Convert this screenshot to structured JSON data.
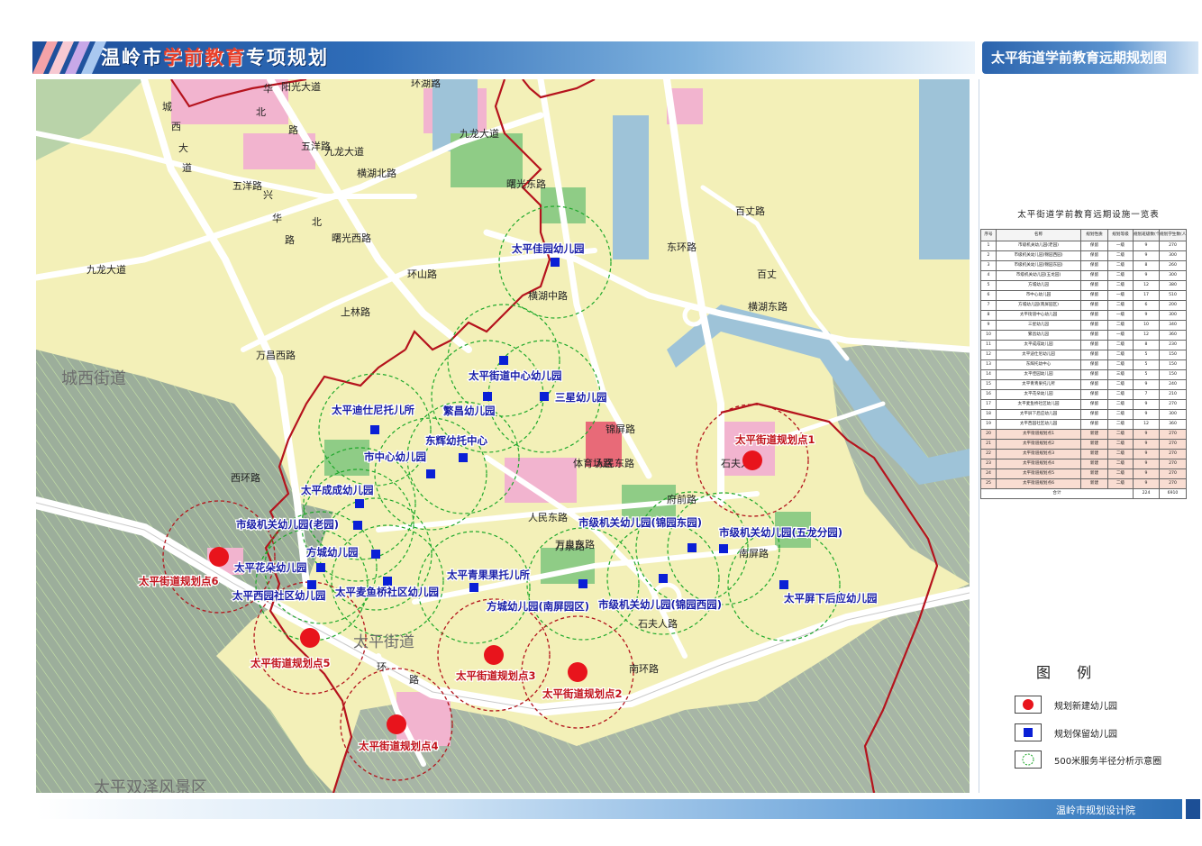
{
  "header": {
    "title_parts": [
      {
        "text": "温岭市",
        "accent": false
      },
      {
        "text": "学前教育",
        "accent": true
      },
      {
        "text": "专项规划",
        "accent": false
      }
    ],
    "right_title": "太平街道学前教育远期规划图"
  },
  "colors": {
    "new_marker": "#e8141c",
    "keep_marker": "#0a1fd6",
    "new_label": "#c1121a",
    "keep_label": "#1a1fa8",
    "radius_new": "#b3141c",
    "radius_keep": "#1ea82a",
    "boundary": "#b5131d"
  },
  "map": {
    "district_labels": [
      {
        "text": "城西街道"
      },
      {
        "text": "太平街道"
      },
      {
        "text": "太平双泽风景区"
      }
    ],
    "road_labels": [
      {
        "text": "阳光大道"
      },
      {
        "text": "华"
      },
      {
        "text": "北"
      },
      {
        "text": "路"
      },
      {
        "text": "城"
      },
      {
        "text": "西"
      },
      {
        "text": "大"
      },
      {
        "text": "道"
      },
      {
        "text": "五洋路"
      },
      {
        "text": "五洋路"
      },
      {
        "text": "横湖北路"
      },
      {
        "text": "九龙大道"
      },
      {
        "text": "九龙大道"
      },
      {
        "text": "九龙大道"
      },
      {
        "text": "曙光东路"
      },
      {
        "text": "曙光西路"
      },
      {
        "text": "环湖路"
      },
      {
        "text": "兴"
      },
      {
        "text": "华"
      },
      {
        "text": "北"
      },
      {
        "text": "路"
      },
      {
        "text": "上林路"
      },
      {
        "text": "万昌西路"
      },
      {
        "text": "环山路"
      },
      {
        "text": "横湖中路"
      },
      {
        "text": "东环路"
      },
      {
        "text": "百丈路"
      },
      {
        "text": "百丈"
      },
      {
        "text": "横湖东路"
      },
      {
        "text": "锦屏路"
      },
      {
        "text": "人民东路"
      },
      {
        "text": "人民东路"
      },
      {
        "text": "万泉东路"
      },
      {
        "text": "万泉路"
      },
      {
        "text": "石夫人路"
      },
      {
        "text": "石夫人路"
      },
      {
        "text": "南屏路"
      },
      {
        "text": "南环路"
      },
      {
        "text": "体育场路"
      },
      {
        "text": "西环路"
      },
      {
        "text": "环"
      },
      {
        "text": "路"
      },
      {
        "text": "府前路"
      }
    ],
    "keep_kindergartens": [
      {
        "label": "太平佳园幼儿园"
      },
      {
        "label": "太平街道中心幼儿园"
      },
      {
        "label": "三星幼儿园"
      },
      {
        "label": "繁昌幼儿园"
      },
      {
        "label": "太平迪仕尼托儿所"
      },
      {
        "label": "东辉幼托中心"
      },
      {
        "label": "市中心幼儿园"
      },
      {
        "label": "太平成成幼儿园"
      },
      {
        "label": "市级机关幼儿园(老园)"
      },
      {
        "label": "方城幼儿园"
      },
      {
        "label": "太平花朵幼儿园"
      },
      {
        "label": "太平西园社区幼儿园"
      },
      {
        "label": "太平麦鱼桥社区幼儿园"
      },
      {
        "label": "太平青果果托儿所"
      },
      {
        "label": "方城幼儿园(南屏园区)"
      },
      {
        "label": "市级机关幼儿园(锦园东园)"
      },
      {
        "label": "市级机关幼儿园(锦园西园)"
      },
      {
        "label": "市级机关幼儿园(五龙分园)"
      },
      {
        "label": "太平屏下后应幼儿园"
      }
    ],
    "new_kindergartens": [
      {
        "label": "太平街道规划点1"
      },
      {
        "label": "太平街道规划点2"
      },
      {
        "label": "太平街道规划点3"
      },
      {
        "label": "太平街道规划点4"
      },
      {
        "label": "太平街道规划点5"
      },
      {
        "label": "太平街道规划点6"
      }
    ]
  },
  "table": {
    "title": "太平街道学前教育远期设施一览表",
    "headers": [
      "序号",
      "名称",
      "规划性质",
      "规划等级",
      "规划班级数(个)",
      "规划学生数(人)"
    ],
    "rows": [
      [
        "1",
        "市级机关幼儿园(老园)",
        "保留",
        "一级",
        "9",
        "270"
      ],
      [
        "2",
        "市级机关幼儿园(锦园西园)",
        "保留",
        "二级",
        "9",
        "300"
      ],
      [
        "3",
        "市级机关幼儿园(锦园东园)",
        "保留",
        "二级",
        "8",
        "260"
      ],
      [
        "4",
        "市级机关幼儿园(五龙园)",
        "保留",
        "二级",
        "9",
        "300"
      ],
      [
        "5",
        "方城幼儿园",
        "保留",
        "二级",
        "12",
        "380"
      ],
      [
        "6",
        "市中心幼儿园",
        "保留",
        "一级",
        "17",
        "510"
      ],
      [
        "7",
        "方城幼儿园(南屏园区)",
        "保留",
        "二级",
        "6",
        "200"
      ],
      [
        "8",
        "太平街道中心幼儿园",
        "保留",
        "一级",
        "9",
        "300"
      ],
      [
        "9",
        "三星幼儿园",
        "保留",
        "二级",
        "10",
        "340"
      ],
      [
        "10",
        "繁昌幼儿园",
        "保留",
        "一级",
        "12",
        "360"
      ],
      [
        "11",
        "太平成成幼儿园",
        "保留",
        "二级",
        "8",
        "230"
      ],
      [
        "12",
        "太平迪仕尼幼儿园",
        "保留",
        "二级",
        "5",
        "150"
      ],
      [
        "13",
        "东辉托幼中心",
        "保留",
        "二级",
        "5",
        "150"
      ],
      [
        "14",
        "太平佳园幼儿园",
        "保留",
        "三级",
        "5",
        "150"
      ],
      [
        "15",
        "太平青青果托儿所",
        "保留",
        "二级",
        "9",
        "240"
      ],
      [
        "16",
        "太平花朵幼儿园",
        "保留",
        "二级",
        "7",
        "210"
      ],
      [
        "17",
        "太平麦鱼桥社区幼儿园",
        "保留",
        "二级",
        "9",
        "270"
      ],
      [
        "18",
        "太平屏下后应幼儿园",
        "保留",
        "二级",
        "9",
        "300"
      ],
      [
        "19",
        "太平西园社区幼儿园",
        "保留",
        "二级",
        "12",
        "360"
      ],
      [
        "20",
        "太平街道规划点1",
        "新建",
        "二级",
        "9",
        "270"
      ],
      [
        "21",
        "太平街道规划点2",
        "新建",
        "二级",
        "9",
        "270"
      ],
      [
        "22",
        "太平街道规划点3",
        "新建",
        "二级",
        "9",
        "270"
      ],
      [
        "23",
        "太平街道规划点4",
        "新建",
        "二级",
        "9",
        "270"
      ],
      [
        "24",
        "太平街道规划点5",
        "新建",
        "二级",
        "9",
        "270"
      ],
      [
        "25",
        "太平街道规划点6",
        "新建",
        "二级",
        "9",
        "270"
      ]
    ],
    "total": {
      "label": "合计",
      "classes": "224",
      "students": "6910"
    }
  },
  "legend": {
    "title": "图 例",
    "items": [
      {
        "label": "规划新建幼儿园",
        "symbol": "red-dot"
      },
      {
        "label": "规划保留幼儿园",
        "symbol": "blue-square"
      },
      {
        "label": "500米服务半径分析示意圈",
        "symbol": "green-circle"
      }
    ]
  },
  "footer": {
    "text": "温岭市规划设计院"
  }
}
